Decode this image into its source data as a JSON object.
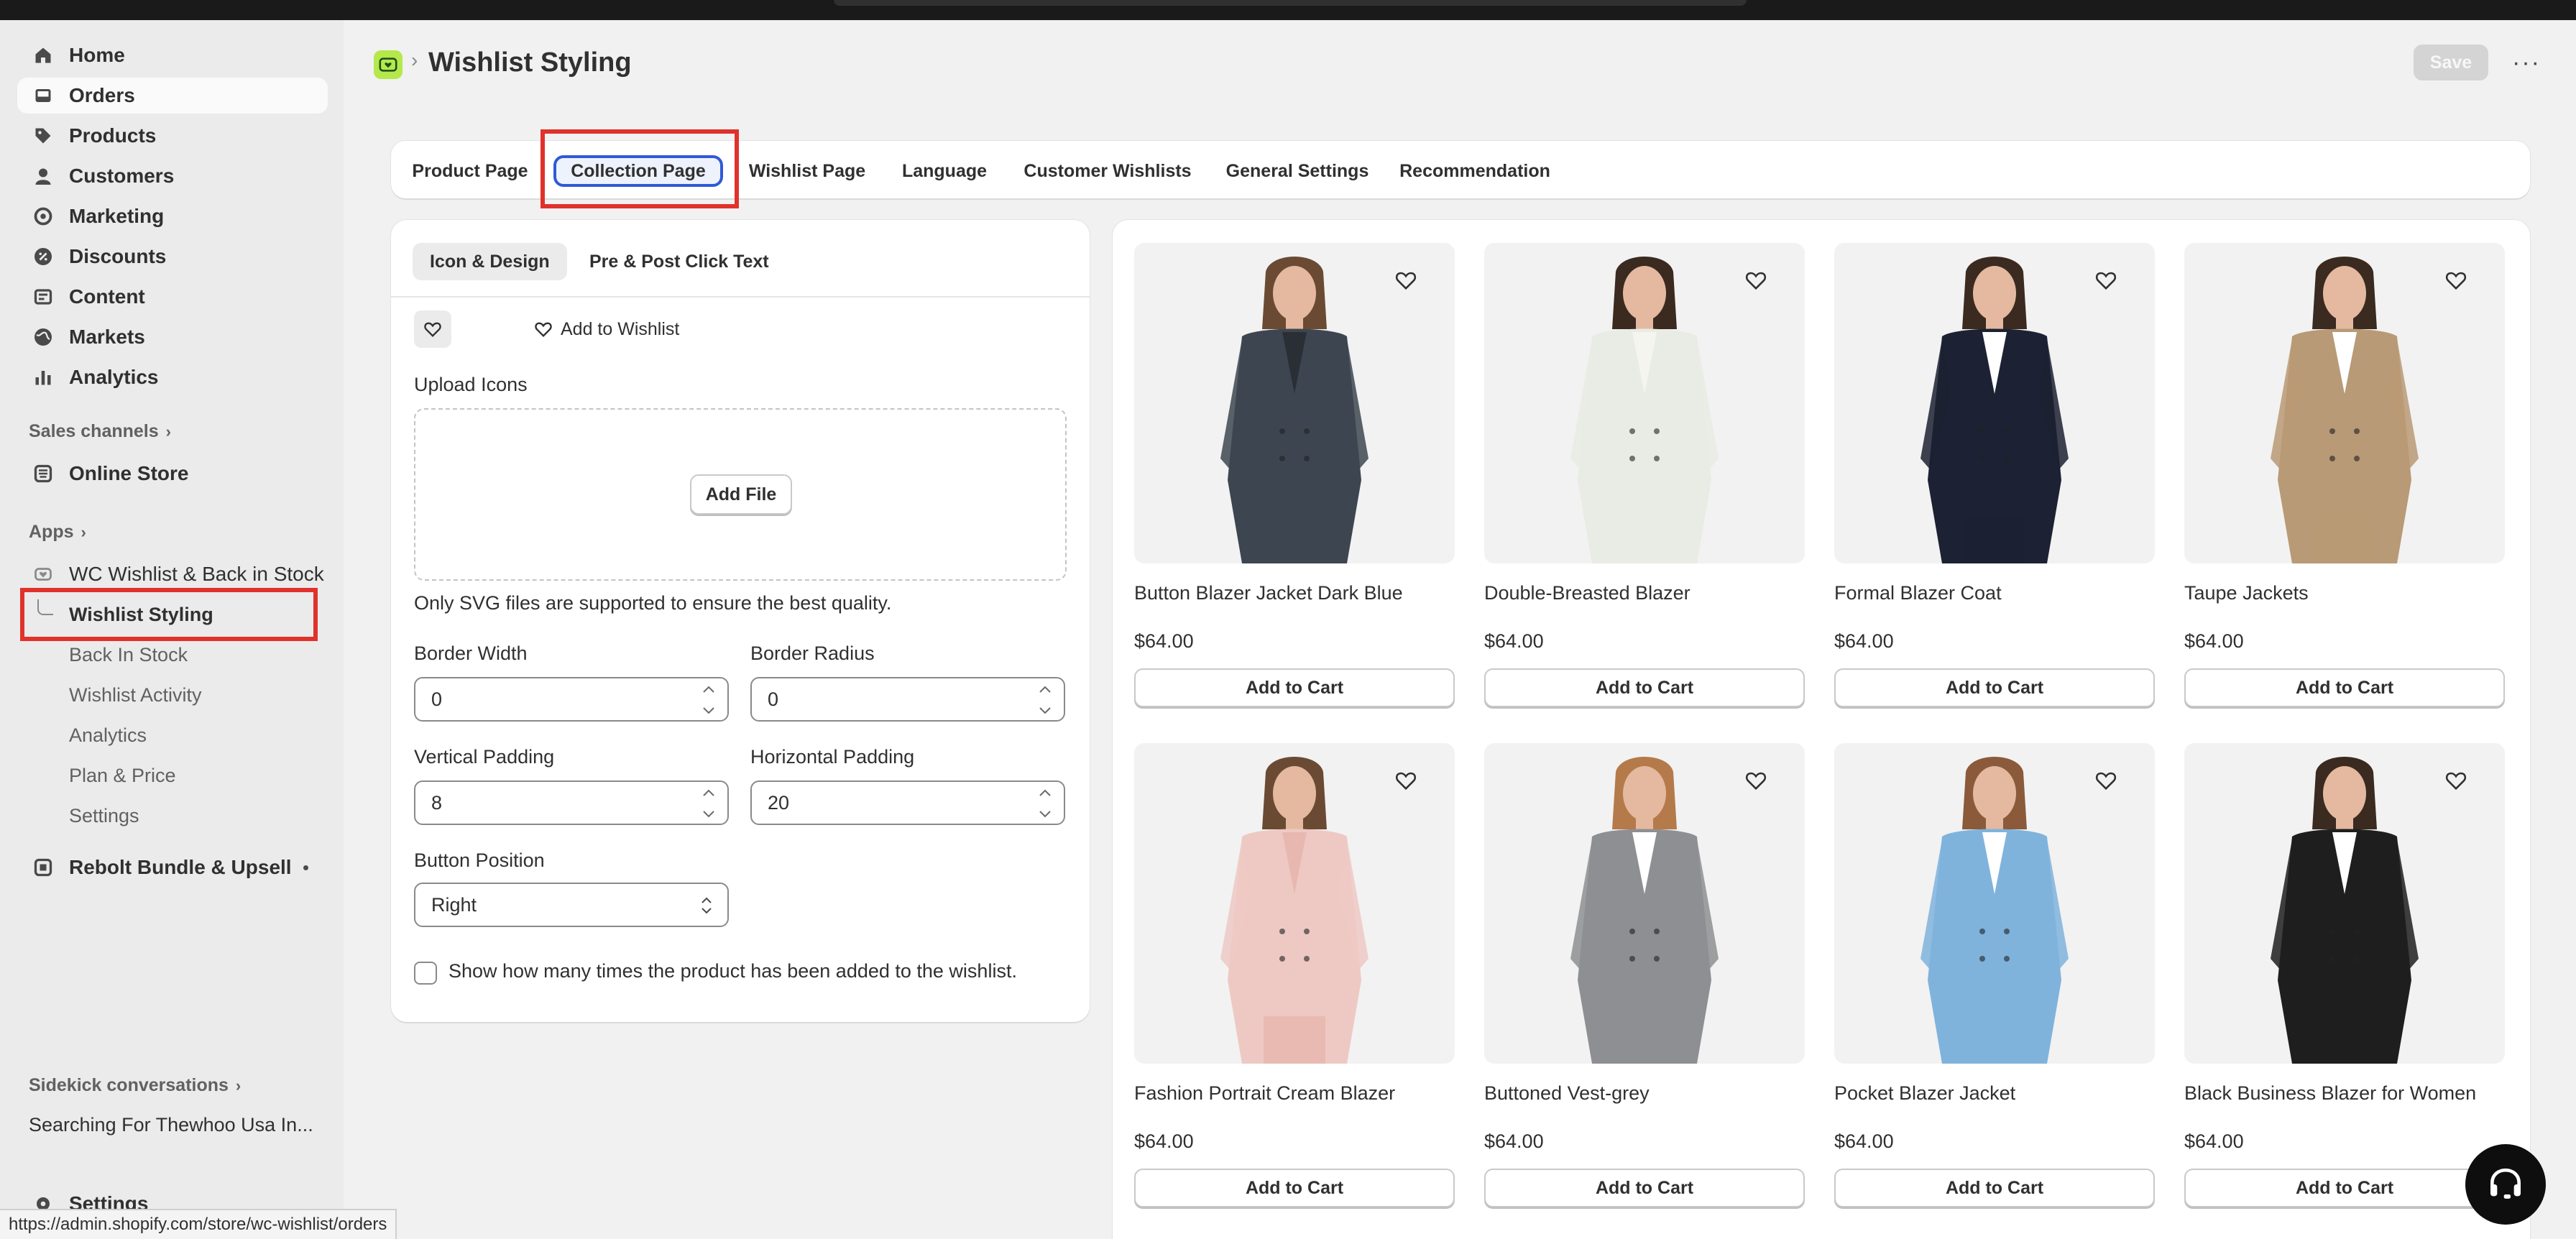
{
  "nav": {
    "items": [
      {
        "label": "Home",
        "icon": "home-icon"
      },
      {
        "label": "Orders",
        "icon": "orders-icon"
      },
      {
        "label": "Products",
        "icon": "tag-icon"
      },
      {
        "label": "Customers",
        "icon": "person-icon"
      },
      {
        "label": "Marketing",
        "icon": "target-icon"
      },
      {
        "label": "Discounts",
        "icon": "discount-icon"
      },
      {
        "label": "Content",
        "icon": "content-icon"
      },
      {
        "label": "Markets",
        "icon": "globe-icon"
      },
      {
        "label": "Analytics",
        "icon": "bar-chart-icon"
      }
    ],
    "sales_channels_label": "Sales channels",
    "online_store": "Online Store",
    "apps_label": "Apps",
    "app_name": "WC Wishlist & Back in Stock",
    "app_sub": [
      "Wishlist Styling",
      "Back In Stock",
      "Wishlist Activity",
      "Analytics",
      "Plan & Price",
      "Settings"
    ],
    "rebolt": "Rebolt Bundle & Upsell",
    "sidekick_label": "Sidekick conversations",
    "sidekick_item": "Searching For Thewhoo Usa In...",
    "settings": "Settings"
  },
  "status_url": "https://admin.shopify.com/store/wc-wishlist/orders",
  "header": {
    "title": "Wishlist Styling",
    "save": "Save",
    "more": "···"
  },
  "tabs": [
    "Product Page",
    "Collection Page",
    "Wishlist Page",
    "Language",
    "Customer Wishlists",
    "General Settings",
    "Recommendation"
  ],
  "settings": {
    "subtabs": [
      "Icon & Design",
      "Pre & Post Click Text"
    ],
    "icon_option_text": "Add to Wishlist",
    "upload_label": "Upload Icons",
    "add_file": "Add File",
    "help": "Only SVG files are supported to ensure the best quality.",
    "border_width_label": "Border Width",
    "border_width": "0",
    "border_radius_label": "Border Radius",
    "border_radius": "0",
    "vertical_padding_label": "Vertical Padding",
    "vertical_padding": "8",
    "horizontal_padding_label": "Horizontal Padding",
    "horizontal_padding": "20",
    "button_position_label": "Button Position",
    "button_position": "Right",
    "show_count_label": "Show how many times the product has been added to the wishlist."
  },
  "products": [
    {
      "name": "Button Blazer Jacket Dark Blue",
      "price": "$64.00",
      "cta": "Add to Cart",
      "jacket": "#3d4650",
      "inner": "#2a2f36",
      "skin": "#e4b9a0",
      "hair": "#6b4a33",
      "pants": "#3d4650"
    },
    {
      "name": "Double-Breasted Blazer",
      "price": "$64.00",
      "cta": "Add to Cart",
      "jacket": "#e9ece4",
      "inner": "#f5f5f0",
      "skin": "#e4b9a0",
      "hair": "#3a2a20",
      "pants": "#e9ece4"
    },
    {
      "name": "Formal Blazer Coat",
      "price": "$64.00",
      "cta": "Add to Cart",
      "jacket": "#1c2133",
      "inner": "#ffffff",
      "skin": "#e4b9a0",
      "hair": "#3a2a20",
      "pants": "#1c2133"
    },
    {
      "name": "Taupe Jackets",
      "price": "$64.00",
      "cta": "Add to Cart",
      "jacket": "#b89a76",
      "inner": "#ffffff",
      "skin": "#e4b9a0",
      "hair": "#3a2a20",
      "pants": "#b89a76"
    },
    {
      "name": "Fashion Portrait Cream Blazer",
      "price": "$64.00",
      "cta": "Add to Cart",
      "jacket": "#eec9c4",
      "inner": "#e8b8b0",
      "skin": "#e4b9a0",
      "hair": "#6b4a33",
      "pants": "#e8b8b0"
    },
    {
      "name": "Buttoned Vest-grey",
      "price": "$64.00",
      "cta": "Add to Cart",
      "jacket": "#8e8f92",
      "inner": "#ffffff",
      "skin": "#e4b9a0",
      "hair": "#b57a4a",
      "pants": "#8e8f92"
    },
    {
      "name": "Pocket Blazer Jacket",
      "price": "$64.00",
      "cta": "Add to Cart",
      "jacket": "#7fb3dc",
      "inner": "#ffffff",
      "skin": "#e4b9a0",
      "hair": "#8a5a3a",
      "pants": "#7fb3dc"
    },
    {
      "name": "Black Business Blazer for Women",
      "price": "$64.00",
      "cta": "Add to Cart",
      "jacket": "#1e1e1e",
      "inner": "#ffffff",
      "skin": "#e4b9a0",
      "hair": "#3a2a20",
      "pants": "#1e1e1e"
    }
  ],
  "colors": {
    "highlight": "#e0322b",
    "active_tab_border": "#2f5ad6",
    "app_icon": "#b5e84a"
  }
}
